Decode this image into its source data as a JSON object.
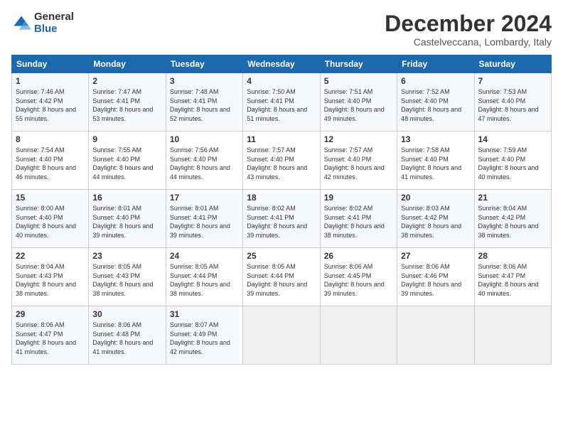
{
  "logo": {
    "general": "General",
    "blue": "Blue"
  },
  "header": {
    "month": "December 2024",
    "location": "Castelveccana, Lombardy, Italy"
  },
  "weekdays": [
    "Sunday",
    "Monday",
    "Tuesday",
    "Wednesday",
    "Thursday",
    "Friday",
    "Saturday"
  ],
  "weeks": [
    [
      {
        "day": "1",
        "sunrise": "7:46 AM",
        "sunset": "4:42 PM",
        "daylight": "8 hours and 55 minutes."
      },
      {
        "day": "2",
        "sunrise": "7:47 AM",
        "sunset": "4:41 PM",
        "daylight": "8 hours and 53 minutes."
      },
      {
        "day": "3",
        "sunrise": "7:48 AM",
        "sunset": "4:41 PM",
        "daylight": "8 hours and 52 minutes."
      },
      {
        "day": "4",
        "sunrise": "7:50 AM",
        "sunset": "4:41 PM",
        "daylight": "8 hours and 51 minutes."
      },
      {
        "day": "5",
        "sunrise": "7:51 AM",
        "sunset": "4:40 PM",
        "daylight": "8 hours and 49 minutes."
      },
      {
        "day": "6",
        "sunrise": "7:52 AM",
        "sunset": "4:40 PM",
        "daylight": "8 hours and 48 minutes."
      },
      {
        "day": "7",
        "sunrise": "7:53 AM",
        "sunset": "4:40 PM",
        "daylight": "8 hours and 47 minutes."
      }
    ],
    [
      {
        "day": "8",
        "sunrise": "7:54 AM",
        "sunset": "4:40 PM",
        "daylight": "8 hours and 46 minutes."
      },
      {
        "day": "9",
        "sunrise": "7:55 AM",
        "sunset": "4:40 PM",
        "daylight": "8 hours and 44 minutes."
      },
      {
        "day": "10",
        "sunrise": "7:56 AM",
        "sunset": "4:40 PM",
        "daylight": "8 hours and 44 minutes."
      },
      {
        "day": "11",
        "sunrise": "7:57 AM",
        "sunset": "4:40 PM",
        "daylight": "8 hours and 43 minutes."
      },
      {
        "day": "12",
        "sunrise": "7:57 AM",
        "sunset": "4:40 PM",
        "daylight": "8 hours and 42 minutes."
      },
      {
        "day": "13",
        "sunrise": "7:58 AM",
        "sunset": "4:40 PM",
        "daylight": "8 hours and 41 minutes."
      },
      {
        "day": "14",
        "sunrise": "7:59 AM",
        "sunset": "4:40 PM",
        "daylight": "8 hours and 40 minutes."
      }
    ],
    [
      {
        "day": "15",
        "sunrise": "8:00 AM",
        "sunset": "4:40 PM",
        "daylight": "8 hours and 40 minutes."
      },
      {
        "day": "16",
        "sunrise": "8:01 AM",
        "sunset": "4:40 PM",
        "daylight": "8 hours and 39 minutes."
      },
      {
        "day": "17",
        "sunrise": "8:01 AM",
        "sunset": "4:41 PM",
        "daylight": "8 hours and 39 minutes."
      },
      {
        "day": "18",
        "sunrise": "8:02 AM",
        "sunset": "4:41 PM",
        "daylight": "8 hours and 39 minutes."
      },
      {
        "day": "19",
        "sunrise": "8:02 AM",
        "sunset": "4:41 PM",
        "daylight": "8 hours and 38 minutes."
      },
      {
        "day": "20",
        "sunrise": "8:03 AM",
        "sunset": "4:42 PM",
        "daylight": "8 hours and 38 minutes."
      },
      {
        "day": "21",
        "sunrise": "8:04 AM",
        "sunset": "4:42 PM",
        "daylight": "8 hours and 38 minutes."
      }
    ],
    [
      {
        "day": "22",
        "sunrise": "8:04 AM",
        "sunset": "4:43 PM",
        "daylight": "8 hours and 38 minutes."
      },
      {
        "day": "23",
        "sunrise": "8:05 AM",
        "sunset": "4:43 PM",
        "daylight": "8 hours and 38 minutes."
      },
      {
        "day": "24",
        "sunrise": "8:05 AM",
        "sunset": "4:44 PM",
        "daylight": "8 hours and 38 minutes."
      },
      {
        "day": "25",
        "sunrise": "8:05 AM",
        "sunset": "4:44 PM",
        "daylight": "8 hours and 39 minutes."
      },
      {
        "day": "26",
        "sunrise": "8:06 AM",
        "sunset": "4:45 PM",
        "daylight": "8 hours and 39 minutes."
      },
      {
        "day": "27",
        "sunrise": "8:06 AM",
        "sunset": "4:46 PM",
        "daylight": "8 hours and 39 minutes."
      },
      {
        "day": "28",
        "sunrise": "8:06 AM",
        "sunset": "4:47 PM",
        "daylight": "8 hours and 40 minutes."
      }
    ],
    [
      {
        "day": "29",
        "sunrise": "8:06 AM",
        "sunset": "4:47 PM",
        "daylight": "8 hours and 41 minutes."
      },
      {
        "day": "30",
        "sunrise": "8:06 AM",
        "sunset": "4:48 PM",
        "daylight": "8 hours and 41 minutes."
      },
      {
        "day": "31",
        "sunrise": "8:07 AM",
        "sunset": "4:49 PM",
        "daylight": "8 hours and 42 minutes."
      },
      null,
      null,
      null,
      null
    ]
  ],
  "labels": {
    "sunrise": "Sunrise:",
    "sunset": "Sunset:",
    "daylight": "Daylight:"
  }
}
